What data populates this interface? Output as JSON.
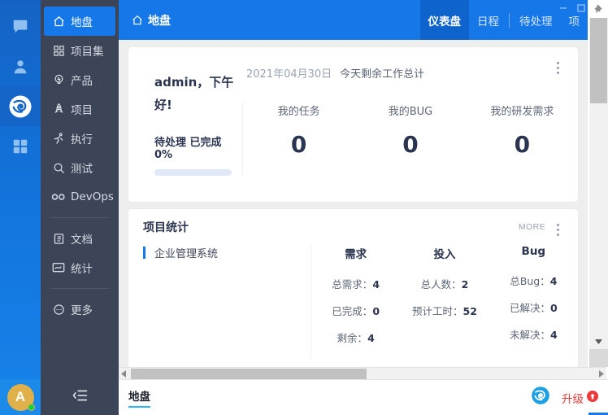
{
  "window": {
    "minimize_label": "—",
    "maximize_label": "▢",
    "pin_icon": "pin-icon"
  },
  "rail": {
    "items": [
      {
        "name": "chat-icon",
        "label": "",
        "active": false
      },
      {
        "name": "contacts-icon",
        "label": "",
        "active": false
      },
      {
        "name": "zentao-logo-icon",
        "label": "",
        "active": true
      },
      {
        "name": "apps-grid-icon",
        "label": "",
        "active": false
      }
    ],
    "avatar": {
      "initial": "A",
      "status": "online"
    }
  },
  "sidebar": {
    "items": [
      {
        "label": "地盘",
        "icon": "home-icon",
        "active": true
      },
      {
        "label": "项目集",
        "icon": "program-grid-icon",
        "active": false
      },
      {
        "label": "产品",
        "icon": "lightbulb-icon",
        "active": false
      },
      {
        "label": "项目",
        "icon": "rocket-icon",
        "active": false
      },
      {
        "label": "执行",
        "icon": "runner-icon",
        "active": false
      },
      {
        "label": "测试",
        "icon": "magnifier-icon",
        "active": false
      },
      {
        "label": "DevOps",
        "icon": "infinity-icon",
        "active": false
      }
    ],
    "items2": [
      {
        "label": "文档",
        "icon": "document-icon",
        "active": false
      },
      {
        "label": "统计",
        "icon": "chart-monitor-icon",
        "active": false
      }
    ],
    "items3": [
      {
        "label": "更多",
        "icon": "ellipsis-circle-icon",
        "active": false
      }
    ],
    "collapse_icon": "collapse-menu-icon"
  },
  "topbar": {
    "brand": "地盘",
    "brand_icon": "home-icon",
    "nav": [
      {
        "label": "仪表盘",
        "active": true
      },
      {
        "label": "日程",
        "active": false
      },
      {
        "label": "待处理",
        "active": false
      },
      {
        "label": "项",
        "active": false
      }
    ]
  },
  "greeting": {
    "hello": "admin，下午好!",
    "pending_label": "待处理 已完成0%",
    "progress_percent": 0,
    "date": "2021年04月30日",
    "summary_label": "今天剩余工作总计",
    "stats": [
      {
        "label": "我的任务",
        "value": "0"
      },
      {
        "label": "我的BUG",
        "value": "0"
      },
      {
        "label": "我的研发需求",
        "value": "0"
      }
    ]
  },
  "project_stats": {
    "title": "项目统计",
    "more_label": "MORE",
    "projects": [
      {
        "name": "企业管理系统"
      }
    ],
    "columns": [
      {
        "header": "需求",
        "rows": [
          {
            "label": "总需求：",
            "value": "4"
          },
          {
            "label": "已完成：",
            "value": "0"
          },
          {
            "label": "剩余：",
            "value": "4"
          }
        ]
      },
      {
        "header": "投入",
        "rows": [
          {
            "label": "总人数：",
            "value": "2"
          },
          {
            "label": "预计工时：",
            "value": "52"
          },
          {
            "label": "",
            "value": ""
          }
        ]
      },
      {
        "header": "Bug",
        "rows": [
          {
            "label": "总Bug：",
            "value": "4"
          },
          {
            "label": "已解决：",
            "value": "0"
          },
          {
            "label": "未解决：",
            "value": "4"
          }
        ]
      }
    ]
  },
  "taskbar": {
    "tab_label": "地盘",
    "logo_icon": "zentao-logo-icon",
    "upgrade_label": "升级",
    "upgrade_icon": "upgrade-arrow-icon"
  },
  "colors": {
    "brand_blue": "#1677e8",
    "sidebar_dark": "#3c4558",
    "accent_cyan": "#29b6f6",
    "upgrade_red": "#ee3a3a",
    "avatar_gold": "#e0b04a"
  }
}
